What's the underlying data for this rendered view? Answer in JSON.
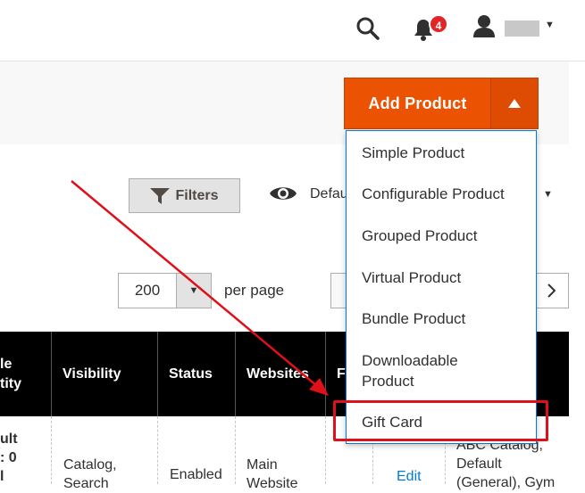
{
  "header": {
    "notifications_count": "4"
  },
  "actions": {
    "add_product_label": "Add Product"
  },
  "add_product_menu": {
    "items": [
      "Simple Product",
      "Configurable Product",
      "Grouped Product",
      "Virtual Product",
      "Bundle Product",
      "Downloadable Product",
      "Gift Card"
    ]
  },
  "toolbar": {
    "filters_label": "Filters",
    "view_label": "Defau"
  },
  "pagination": {
    "per_page_value": "200",
    "per_page_label": "per page"
  },
  "table": {
    "columns": [
      "le\ntity",
      "Visibility",
      "Status",
      "Websites",
      "F"
    ],
    "row": {
      "quantity": "ult\n: 0\nl",
      "visibility": "Catalog,\nSearch",
      "status": "Enabled",
      "websites": "Main\nWebsite",
      "action": "Edit",
      "attribute_set": "ABC Catalog,\nDefault\n(General), Gym"
    }
  },
  "colors": {
    "accent": "#eb5202",
    "link": "#007bdb",
    "annotation": "#e0101a",
    "badge": "#e22626"
  }
}
